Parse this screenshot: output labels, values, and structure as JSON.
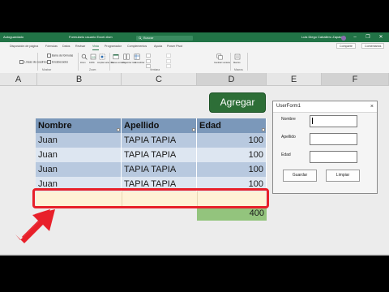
{
  "titlebar": {
    "filename": "Formulario usuario Excel.xlsm",
    "search_placeholder": "Buscar",
    "user": "Luis Diego Caballero Zapata",
    "autosave": "Autoguardado"
  },
  "ribbon_tabs": [
    "Disposición de página",
    "Fórmulas",
    "Datos",
    "Revisar",
    "Vista",
    "Programador",
    "Complementos",
    "Ayuda",
    "Power Pivot"
  ],
  "active_tab": "Vista",
  "share_label": "Compartir",
  "comments_label": "Comentarios",
  "ribbon": {
    "show_group": {
      "items": [
        "Barra de fórmulas",
        "Líneas de cuadrícula",
        "Encabezados"
      ],
      "name": "Mostrar"
    },
    "zoom_group": {
      "items": [
        "Zoom",
        "100%",
        "Ampliar selección"
      ],
      "name": "Zoom"
    },
    "window_group": {
      "items": [
        "Nueva ventana",
        "Organizar todo",
        "Inmovilizar"
      ],
      "name": "Ventana"
    },
    "switch_windows": "Cambiar ventanas",
    "macros": {
      "label": "Macros",
      "name": "Macros"
    }
  },
  "columns": [
    "A",
    "B",
    "C",
    "D",
    "E",
    "F"
  ],
  "selected_columns": [
    "D",
    "F"
  ],
  "table": {
    "headers": [
      "Nombre",
      "Apellido",
      "Edad"
    ],
    "rows": [
      [
        "Juan",
        "TAPIA TAPIA",
        "100"
      ],
      [
        "Juan",
        "TAPIA TAPIA",
        "100"
      ],
      [
        "Juan",
        "TAPIA TAPIA",
        "100"
      ],
      [
        "Juan",
        "TAPIA TAPIA",
        "100"
      ]
    ],
    "total": "400"
  },
  "agregar_button": "Agregar",
  "userform": {
    "title": "UserForm1",
    "close": "×",
    "fields": [
      {
        "label": "Nombre",
        "value": ""
      },
      {
        "label": "Apellido",
        "value": ""
      },
      {
        "label": "Edad",
        "value": ""
      }
    ],
    "save_button": "Guardar",
    "clear_button": "Limpiar"
  },
  "colors": {
    "excel_green": "#217346",
    "header_row": "#7b98ba",
    "band_dark": "#b8c9df",
    "band_light": "#dde6f1",
    "total_cell": "#93c47d",
    "highlight": "#e8202a",
    "new_row": "#fff2d6"
  }
}
